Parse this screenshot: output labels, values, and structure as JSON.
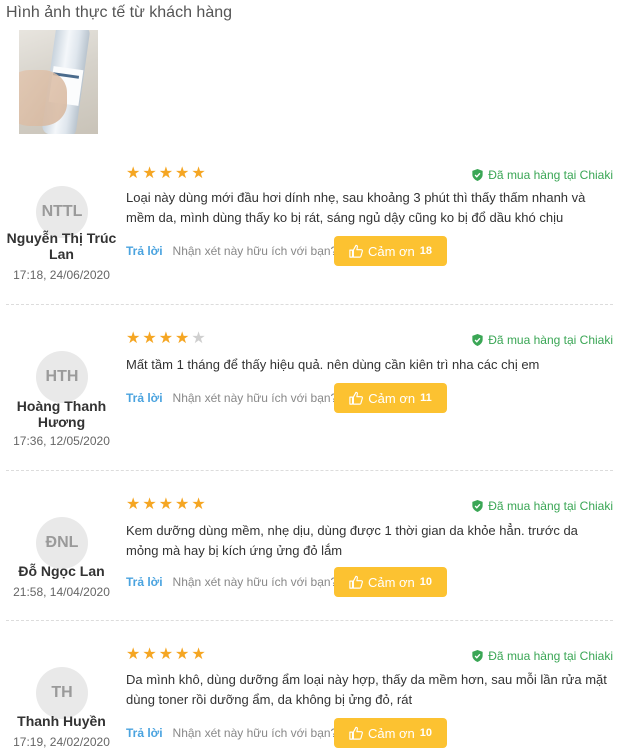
{
  "section_title": "Hình ảnh thực tế từ khách hàng",
  "helpful_question": "Nhận xét này hữu ích với bạn?",
  "reply_label": "Trả lời",
  "thanks_label": "Cảm ơn",
  "verified_label": "Đã mua hàng tại Chiaki",
  "colors": {
    "star": "#f5a623",
    "star_empty": "#cfcfcf",
    "verified": "#3aa655",
    "button": "#fcc231",
    "link": "#4aa3df"
  },
  "reviews": [
    {
      "initials": "NTTL",
      "name": "Nguyễn Thị Trúc Lan",
      "date": "17:18, 24/06/2020",
      "rating": 5,
      "comment": "Loại này dùng mới đầu hơi dính nhẹ, sau khoảng 3 phút thì thấy thấm nhanh và mềm da, mình dùng thấy ko bị rát, sáng ngủ dậy cũng ko bị đổ dầu khó chịu",
      "thanks_count": "18"
    },
    {
      "initials": "HTH",
      "name": "Hoàng Thanh Hương",
      "date": "17:36, 12/05/2020",
      "rating": 4,
      "comment": "Mất tầm 1 tháng để thấy hiệu quả. nên dùng cần kiên trì nha các chị em",
      "thanks_count": "11"
    },
    {
      "initials": "ĐNL",
      "name": "Đỗ Ngọc Lan",
      "date": "21:58, 14/04/2020",
      "rating": 5,
      "comment": "Kem dưỡng dùng mềm, nhẹ dịu, dùng được 1 thời gian da khỏe hẳn. trước da mỏng mà hay bị kích ứng ửng đỏ lắm",
      "thanks_count": "10"
    },
    {
      "initials": "TH",
      "name": "Thanh Huyền",
      "date": "17:19, 24/02/2020",
      "rating": 5,
      "comment": "Da mình khô, dùng dưỡng ẩm loại này hợp, thấy da mềm hơn, sau mỗi lần rửa mặt dùng toner rồi dưỡng ẩm, da không bị ửng đỏ, rát",
      "thanks_count": "10"
    }
  ]
}
